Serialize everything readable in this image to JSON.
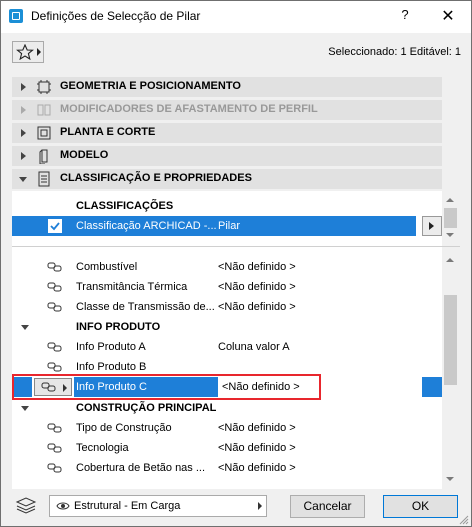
{
  "window": {
    "title": "Definições de Selecção de Pilar",
    "help": "?",
    "close": "✕"
  },
  "header": {
    "selected_info": "Seleccionado: 1 Editável: 1"
  },
  "panels": [
    {
      "label": "GEOMETRIA E POSICIONAMENTO",
      "expanded": false,
      "enabled": true
    },
    {
      "label": "MODIFICADORES DE AFASTAMENTO DE PERFIL",
      "expanded": false,
      "enabled": false
    },
    {
      "label": "PLANTA E CORTE",
      "expanded": false,
      "enabled": true
    },
    {
      "label": "MODELO",
      "expanded": false,
      "enabled": true
    },
    {
      "label": "CLASSIFICAÇÃO E PROPRIEDADES",
      "expanded": true,
      "enabled": true
    }
  ],
  "classifications": {
    "heading": "CLASSIFICAÇÕES",
    "row": {
      "name": "Classificação ARCHICAD -...",
      "value": "Pilar",
      "checked": true
    }
  },
  "properties": {
    "rows": [
      {
        "name": "Combustível",
        "value": "<Não definido >"
      },
      {
        "name": "Transmitância Térmica",
        "value": "<Não definido >"
      },
      {
        "name": "Classe de Transmissão de...",
        "value": "<Não definido >"
      }
    ],
    "info_group": "INFO PRODUTO",
    "info_rows": [
      {
        "name": "Info Produto A",
        "value": "Coluna valor A"
      },
      {
        "name": "Info Produto B",
        "value": ""
      },
      {
        "name": "Info Produto C",
        "value": "<Não definido >"
      }
    ],
    "construction_group": "CONSTRUÇÃO PRINCIPAL",
    "construction_rows": [
      {
        "name": "Tipo de Construção",
        "value": "<Não definido >"
      },
      {
        "name": "Tecnologia",
        "value": "<Não definido >"
      },
      {
        "name": "Cobertura de Betão nas ...",
        "value": "<Não definido >"
      }
    ]
  },
  "footer": {
    "layer": "Estrutural - Em Carga",
    "cancel": "Cancelar",
    "ok": "OK"
  },
  "colors": {
    "selection": "#1e7fd8",
    "highlight_box": "#e8262d",
    "panel_bg": "#e1e1e1"
  }
}
